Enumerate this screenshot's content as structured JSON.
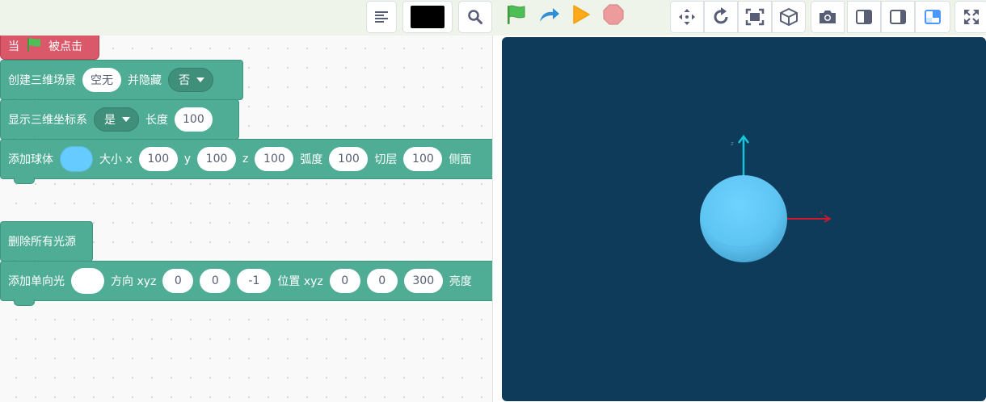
{
  "toolbar": {
    "buttons": [
      {
        "name": "code-view-icon"
      },
      {
        "name": "color-picker-swatch",
        "color": "#000000"
      },
      {
        "name": "search-icon"
      }
    ],
    "run_controls": [
      {
        "name": "green-flag-icon",
        "color": "#4cbf56"
      },
      {
        "name": "redo-arrow-icon",
        "color": "#4c97ff"
      },
      {
        "name": "run-play-icon",
        "color": "#ffab19"
      },
      {
        "name": "stop-icon",
        "color": "#ec9c9c"
      }
    ],
    "stage_tools": [
      {
        "name": "move-icon"
      },
      {
        "name": "rotate-icon"
      },
      {
        "name": "fit-screen-icon"
      },
      {
        "name": "cube-3d-icon"
      },
      {
        "name": "camera-icon"
      },
      {
        "name": "layout-left-icon"
      },
      {
        "name": "layout-right-icon"
      },
      {
        "name": "layout-small-stage-icon",
        "active": true,
        "color": "#4c97ff"
      },
      {
        "name": "fullscreen-icon"
      }
    ]
  },
  "script": {
    "hat": {
      "before": "当",
      "after": "被点击",
      "flag_icon": "green-flag-icon"
    },
    "create_scene": {
      "label": "创建三维场景",
      "value": "空无",
      "hide_label": "并隐藏",
      "hide_value": "否"
    },
    "show_axes": {
      "label": "显示三维坐标系",
      "value": "是",
      "length_label": "长度",
      "length": "100"
    },
    "add_sphere": {
      "label": "添加球体",
      "color": "#66ccff",
      "size_label": "大小 x",
      "x": "100",
      "y_label": "y",
      "y": "100",
      "z_label": "z",
      "z": "100",
      "arc_label": "弧度",
      "arc": "100",
      "layers_label": "切层",
      "layers": "100",
      "side_label": "侧面"
    },
    "delete_lights": {
      "label": "删除所有光源"
    },
    "add_light": {
      "label": "添加单向光",
      "color": "#ffffff",
      "dir_label": "方向 xyz",
      "dx": "0",
      "dy": "0",
      "dz": "-1",
      "pos_label": "位置 xyz",
      "px": "0",
      "py": "0",
      "pz": "300",
      "brightness_label": "亮度"
    }
  },
  "stage": {
    "background": "#0f3b5a",
    "sphere_color": "#66ccff",
    "axis_y_label": "z",
    "axis_x_label": "x",
    "axis_y_color": "#19c4d9",
    "axis_x_color": "#d0192b"
  }
}
